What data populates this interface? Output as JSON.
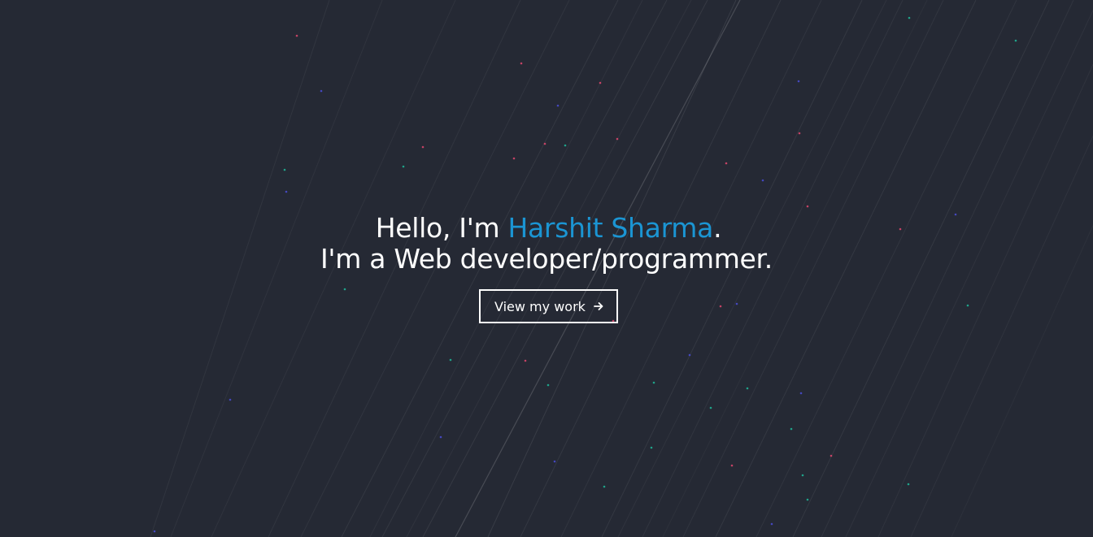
{
  "hero": {
    "greeting": "Hello, I'm ",
    "name": "Harshit Sharma",
    "period": ".",
    "tagline": "I'm a Web developer/programmer.",
    "cta_label": "View my work",
    "cta_icon": "arrow-right-icon"
  },
  "colors": {
    "background": "#252934",
    "accent": "#1b95d3",
    "text": "#ffffff",
    "streak": "#ffffff",
    "dot_colors": [
      "#e0466e",
      "#1fb89a",
      "#4a4ed6"
    ]
  }
}
